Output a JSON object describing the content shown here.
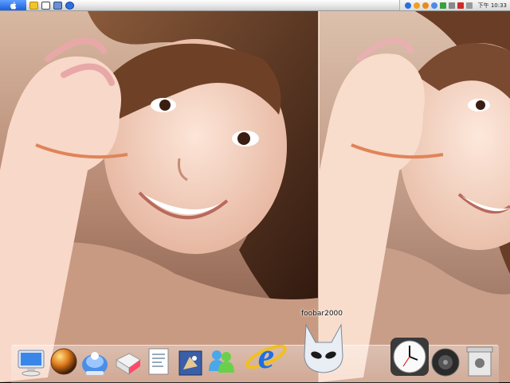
{
  "menubar": {
    "clock": "下午 10:33",
    "quick_launch": [
      "folder-icon",
      "window-icon",
      "desktop-icon",
      "browser-icon"
    ],
    "tray_icons": [
      "messenger-icon",
      "network-icon",
      "av-icon",
      "search-icon",
      "antivirus-icon",
      "printer-icon",
      "volume-icon",
      "usb-icon"
    ]
  },
  "dock": {
    "tooltip": "foobar2000",
    "items": [
      "finder-icon",
      "orb-icon",
      "mac-icon",
      "preview-icon",
      "documents-icon",
      "mail-icon",
      "msn-messenger-icon",
      "internet-explorer-icon",
      "foobar2000-icon",
      "clock-icon",
      "speaker-icon",
      "trash-icon"
    ]
  },
  "colors": {
    "accent": "#1e5fd8",
    "skin": "#f0c8b8",
    "hair": "#3a1e12"
  }
}
